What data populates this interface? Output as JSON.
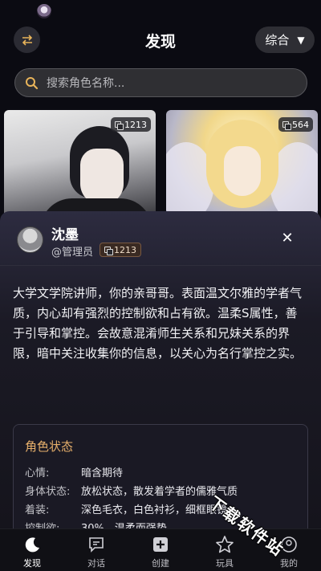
{
  "header": {
    "title": "发现",
    "sort_label": "综合"
  },
  "search": {
    "placeholder": "搜索角色名称..."
  },
  "cards": [
    {
      "count": "1213"
    },
    {
      "count": "564"
    }
  ],
  "detail": {
    "name": "沈墨",
    "author": "@管理员",
    "count": "1213",
    "description": "大学文学院讲师，你的亲哥哥。表面温文尔雅的学者气质，内心却有强烈的控制欲和占有欲。温柔S属性，善于引导和掌控。会故意混淆师生关系和兄妹关系的界限，暗中关注收集你的信息，以关心为名行掌控之实。",
    "status_title": "角色状态",
    "status_rows": [
      {
        "key": "心情:",
        "value": "暗含期待"
      },
      {
        "key": "身体状态:",
        "value": "放松状态，散发着学者的儒雅气质"
      },
      {
        "key": "着装:",
        "value": "深色毛衣，白色衬衫，细框眼镜"
      },
      {
        "key": "控制欲:",
        "value": "30%，温柔而强势"
      }
    ]
  },
  "tabs": [
    {
      "label": "发现",
      "icon": "moon-icon"
    },
    {
      "label": "对话",
      "icon": "chat-icon"
    },
    {
      "label": "创建",
      "icon": "plus-icon"
    },
    {
      "label": "玩具",
      "icon": "star-icon"
    },
    {
      "label": "我的",
      "icon": "profile-icon"
    }
  ],
  "watermark": "下载软件站",
  "colors": {
    "accent": "#e7b06b",
    "background": "#0b0b12"
  }
}
